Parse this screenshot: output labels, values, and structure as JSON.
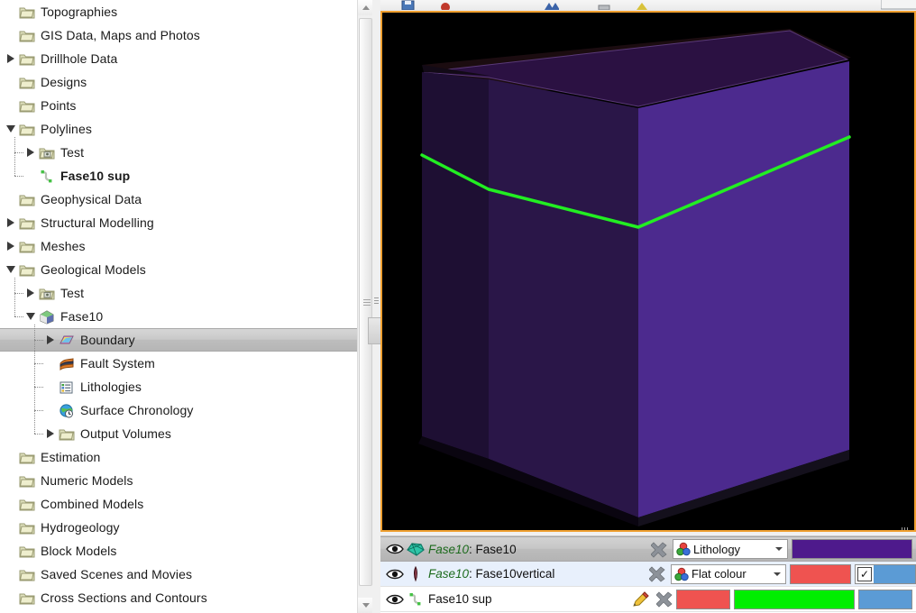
{
  "project_tree": {
    "items": [
      {
        "label": "Topographies",
        "icon": "folder-icon",
        "depth": 1,
        "twisty": "none",
        "bold": false,
        "selected": false
      },
      {
        "label": "GIS Data, Maps and Photos",
        "icon": "folder-icon",
        "depth": 1,
        "twisty": "none",
        "bold": false,
        "selected": false
      },
      {
        "label": "Drillhole Data",
        "icon": "folder-icon",
        "depth": 1,
        "twisty": "right",
        "bold": false,
        "selected": false
      },
      {
        "label": "Designs",
        "icon": "folder-icon",
        "depth": 1,
        "twisty": "none",
        "bold": false,
        "selected": false
      },
      {
        "label": "Points",
        "icon": "folder-icon",
        "depth": 1,
        "twisty": "none",
        "bold": false,
        "selected": false
      },
      {
        "label": "Polylines",
        "icon": "folder-icon",
        "depth": 1,
        "twisty": "down",
        "bold": false,
        "selected": false
      },
      {
        "label": "Test",
        "icon": "folder-photo-icon",
        "depth": 2,
        "twisty": "right",
        "bold": false,
        "selected": false
      },
      {
        "label": "Fase10 sup",
        "icon": "polyline-icon",
        "depth": 2,
        "twisty": "none",
        "bold": true,
        "selected": false
      },
      {
        "label": "Geophysical Data",
        "icon": "folder-icon",
        "depth": 1,
        "twisty": "none",
        "bold": false,
        "selected": false
      },
      {
        "label": "Structural Modelling",
        "icon": "folder-icon",
        "depth": 1,
        "twisty": "right",
        "bold": false,
        "selected": false
      },
      {
        "label": "Meshes",
        "icon": "folder-icon",
        "depth": 1,
        "twisty": "right",
        "bold": false,
        "selected": false
      },
      {
        "label": "Geological Models",
        "icon": "folder-icon",
        "depth": 1,
        "twisty": "down",
        "bold": false,
        "selected": false
      },
      {
        "label": "Test",
        "icon": "folder-photo-icon",
        "depth": 2,
        "twisty": "right",
        "bold": false,
        "selected": false
      },
      {
        "label": "Fase10",
        "icon": "geological-model-icon",
        "depth": 2,
        "twisty": "down",
        "bold": false,
        "selected": false
      },
      {
        "label": "Boundary",
        "icon": "boundary-icon",
        "depth": 3,
        "twisty": "right",
        "bold": false,
        "selected": true
      },
      {
        "label": "Fault System",
        "icon": "fault-system-icon",
        "depth": 3,
        "twisty": "none",
        "bold": false,
        "selected": false
      },
      {
        "label": "Lithologies",
        "icon": "lithologies-icon",
        "depth": 3,
        "twisty": "none",
        "bold": false,
        "selected": false
      },
      {
        "label": "Surface Chronology",
        "icon": "surface-chronology-icon",
        "depth": 3,
        "twisty": "none",
        "bold": false,
        "selected": false
      },
      {
        "label": "Output Volumes",
        "icon": "folder-icon",
        "depth": 3,
        "twisty": "right",
        "bold": false,
        "selected": false
      },
      {
        "label": "Estimation",
        "icon": "folder-icon",
        "depth": 1,
        "twisty": "none",
        "bold": false,
        "selected": false
      },
      {
        "label": "Numeric Models",
        "icon": "folder-icon",
        "depth": 1,
        "twisty": "none",
        "bold": false,
        "selected": false
      },
      {
        "label": "Combined Models",
        "icon": "folder-icon",
        "depth": 1,
        "twisty": "none",
        "bold": false,
        "selected": false
      },
      {
        "label": "Hydrogeology",
        "icon": "folder-icon",
        "depth": 1,
        "twisty": "none",
        "bold": false,
        "selected": false
      },
      {
        "label": "Block Models",
        "icon": "folder-icon",
        "depth": 1,
        "twisty": "none",
        "bold": false,
        "selected": false
      },
      {
        "label": "Saved Scenes and Movies",
        "icon": "folder-icon",
        "depth": 1,
        "twisty": "none",
        "bold": false,
        "selected": false
      },
      {
        "label": "Cross Sections and Contours",
        "icon": "folder-icon",
        "depth": 1,
        "twisty": "none",
        "bold": false,
        "selected": false
      }
    ]
  },
  "scene_list": {
    "rows": [
      {
        "visible": true,
        "icon": "mesh-icon",
        "name_prefix": "Fase10",
        "name_separator": ": ",
        "name_suffix": "Fase10",
        "has_edit": false,
        "has_remove": true,
        "combo": {
          "label": "Lithology",
          "icon": "rgb-spheres-icon"
        },
        "swatches": [
          {
            "name": "colour-swatch-purple",
            "color": "#4e1a8c",
            "width": "wide"
          }
        ],
        "checkbox": null,
        "state": "selected"
      },
      {
        "visible": true,
        "icon": "vertical-fault-icon",
        "name_prefix": "Fase10",
        "name_separator": ": ",
        "name_suffix": "Fase10vertical",
        "has_edit": false,
        "has_remove": true,
        "combo": {
          "label": "Flat colour",
          "icon": "rgb-spheres-icon"
        },
        "swatches": [
          {
            "name": "colour-swatch-red",
            "color": "#ef5350",
            "width": "mid"
          }
        ],
        "checkbox": {
          "checked": true,
          "color": "#5b9bd5"
        },
        "state": "alt"
      },
      {
        "visible": true,
        "icon": "polyline-icon",
        "name_prefix": "",
        "name_separator": "",
        "name_suffix": "Fase10 sup",
        "has_edit": true,
        "has_remove": true,
        "combo": null,
        "swatches": [
          {
            "name": "colour-swatch-red",
            "color": "#ef5350",
            "width": "nar"
          },
          {
            "name": "colour-swatch-green",
            "color": "#00ee00",
            "width": "wide"
          },
          {
            "name": "colour-swatch-blue",
            "color": "#5b9bd5",
            "width": "blue"
          }
        ],
        "checkbox": null,
        "state": "plain"
      }
    ],
    "checkbox_glyph": "✓"
  },
  "viewport": {
    "background": "#000000",
    "border_color": "#f0a030",
    "scene": {
      "object_name": "Fase10 geological model block",
      "top_face_color": "#2b1142",
      "front_left_face_color": "#221038",
      "left_face_color": "#2a164a",
      "right_face_color": "#4e2a8e",
      "mid_face_color": "#382062",
      "polyline_color": "#22ee22"
    }
  },
  "colors": {
    "accent_orange": "#f0a030",
    "purple": "#4e1a8c",
    "red": "#ef5350",
    "blue": "#5b9bd5",
    "green": "#00ee00",
    "selection_gray": "#c0c0c0",
    "row_alt_blue": "#e8f0fc"
  }
}
